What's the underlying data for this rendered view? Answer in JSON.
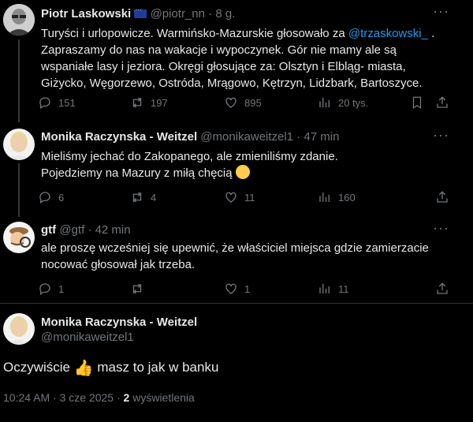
{
  "tweets": [
    {
      "name": "Piotr Laskowski",
      "handle": "@piotr_nn",
      "time": "· 8 g.",
      "text_lines": [
        [
          "Turyści i urlopowicze. Warmińsko-Mazurskie głosowało za ",
          "@trzaskowski_",
          " ."
        ],
        [
          "Zapraszamy do nas na wakacje i wypoczynek. Gór nie mamy ale są"
        ],
        [
          "wspaniałe lasy i jeziora. Okręgi głosujące za: Olsztyn i Elbląg- miasta,"
        ],
        [
          "Giżycko, Węgorzewo, Ostróda, Mrągowo, Kętrzyn, Lidzbark, Bartoszyce."
        ]
      ],
      "replies": "151",
      "reposts": "197",
      "likes": "895",
      "views": "20 tys."
    },
    {
      "name": "Monika Raczynska - Weitzel",
      "handle": "@monikaweitzel1",
      "time": "· 47 min",
      "text_lines": [
        [
          "Mieliśmy jechać do Zakopanego, ale zmieniliśmy zdanie."
        ],
        [
          "Pojedziemy na Mazury z miłą chęcią"
        ]
      ],
      "replies": "6",
      "reposts": "4",
      "likes": "11",
      "views": "160"
    },
    {
      "name": "gtf",
      "handle": "@gtf",
      "time": "· 42 min",
      "text_lines": [
        [
          "ale proszę wcześniej się upewnić, że właściciel miejsca gdzie zamierzacie"
        ],
        [
          "nocować głosował jak trzeba."
        ]
      ],
      "replies": "1",
      "reposts": "",
      "likes": "1",
      "views": "11"
    }
  ],
  "main": {
    "name": "Monika Raczynska - Weitzel",
    "handle": "@monikaweitzel1",
    "text_before": "Oczywiście",
    "text_after": "masz to jak w banku",
    "timestamp": "10:24 AM · 3 cze 2025 ·",
    "views_count": "2",
    "views_label": "wyświetlenia"
  },
  "icons": {
    "more": "more-dots-icon",
    "reply": "reply-icon",
    "repost": "repost-icon",
    "like": "heart-icon",
    "views": "views-icon",
    "bookmark": "bookmark-icon",
    "share": "share-icon"
  },
  "colors": {
    "link": "#1d9bf0",
    "muted": "#71767b",
    "bg": "#000000"
  }
}
